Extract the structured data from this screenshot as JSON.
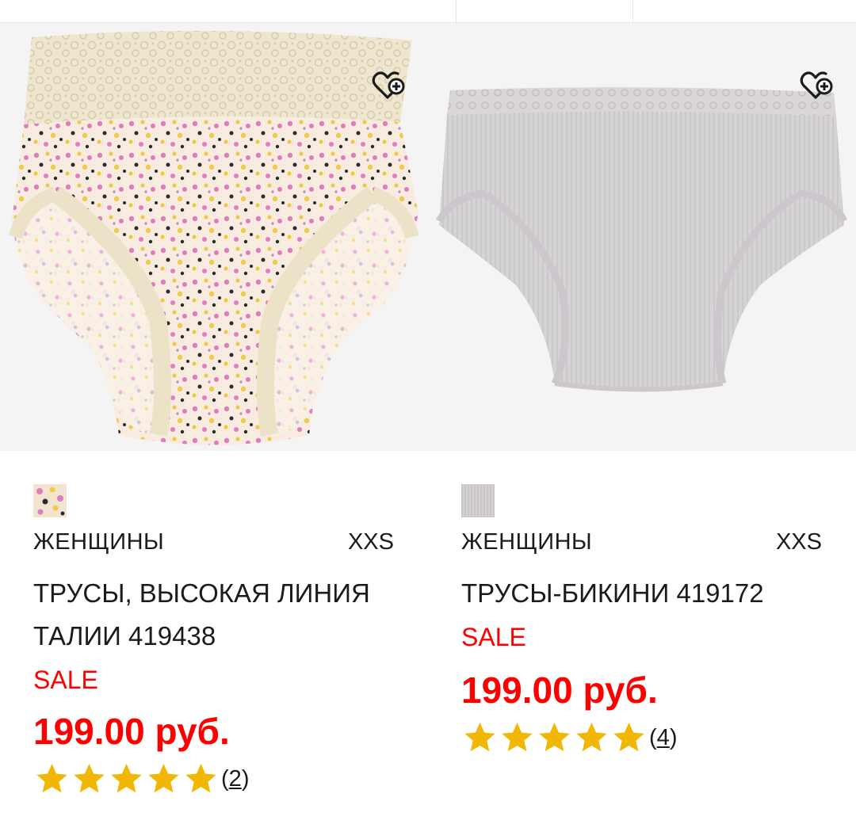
{
  "products": [
    {
      "gender": "ЖЕНЩИНЫ",
      "size": "XXS",
      "name": "ТРУСЫ, ВЫСОКАЯ ЛИНИЯ ТАЛИИ 419438",
      "sale_label": "SALE",
      "price": "199.00 руб.",
      "rating": 5,
      "review_count": "2",
      "swatch_color": "#e8c7a8",
      "wishlist_icon": "heart-plus-icon"
    },
    {
      "gender": "ЖЕНЩИНЫ",
      "size": "XXS",
      "name": "ТРУСЫ-БИКИНИ 419172",
      "sale_label": "SALE",
      "price": "199.00 руб.",
      "rating": 5,
      "review_count": "4",
      "swatch_color": "#cfcdcd",
      "wishlist_icon": "heart-plus-icon"
    }
  ],
  "colors": {
    "sale": "#ff0000",
    "star": "#f2b705",
    "image_bg": "#f4f4f5"
  }
}
